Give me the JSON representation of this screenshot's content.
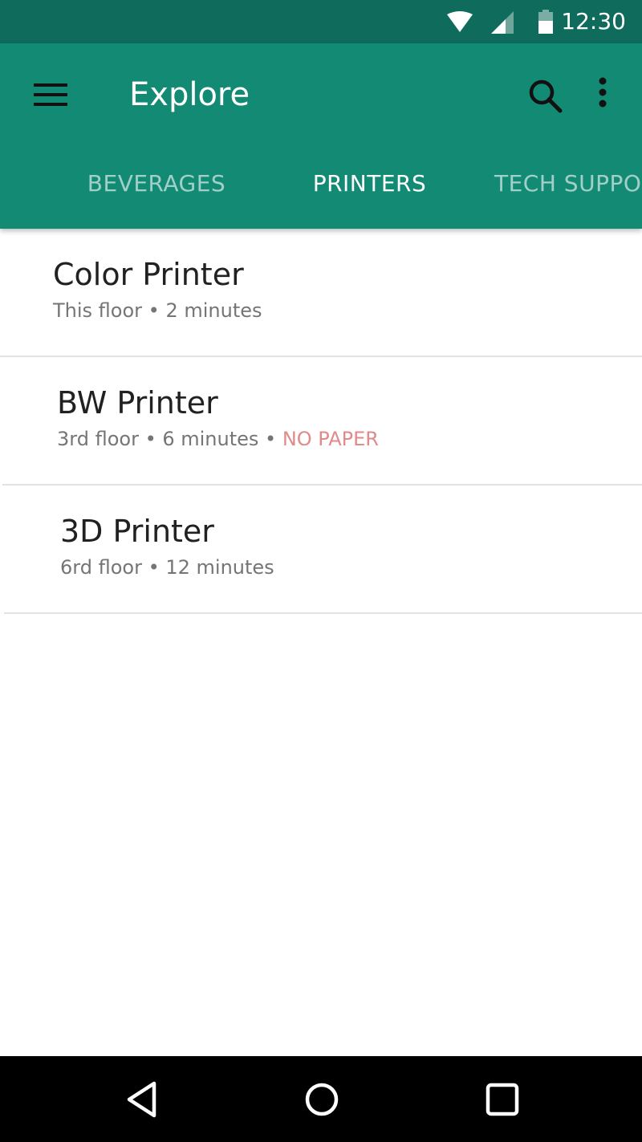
{
  "status_bar": {
    "time": "12:30",
    "icons": [
      "wifi-icon",
      "signal-icon",
      "battery-icon"
    ]
  },
  "app_bar": {
    "title": "Explore",
    "icons": [
      "menu-icon",
      "search-icon",
      "more-vert-icon"
    ],
    "color": "#128a74",
    "status_color": "#0f6b5b"
  },
  "tabs": [
    {
      "label": "BEVERAGES",
      "active": false
    },
    {
      "label": "PRINTERS",
      "active": true
    },
    {
      "label": "TECH SUPPO",
      "active": false
    }
  ],
  "items": [
    {
      "title": "Color Printer",
      "location": "This floor",
      "time": "2 minutes",
      "status": ""
    },
    {
      "title": "BW Printer",
      "location": "3rd floor",
      "time": "6 minutes",
      "status": "NO PAPER"
    },
    {
      "title": "3D Printer",
      "location": "6rd floor",
      "time": "12 minutes",
      "status": ""
    }
  ],
  "separator": " • ",
  "status_color": "#e08a8a",
  "nav_bar": {
    "icons": [
      "back-icon",
      "home-icon",
      "recents-icon"
    ]
  }
}
